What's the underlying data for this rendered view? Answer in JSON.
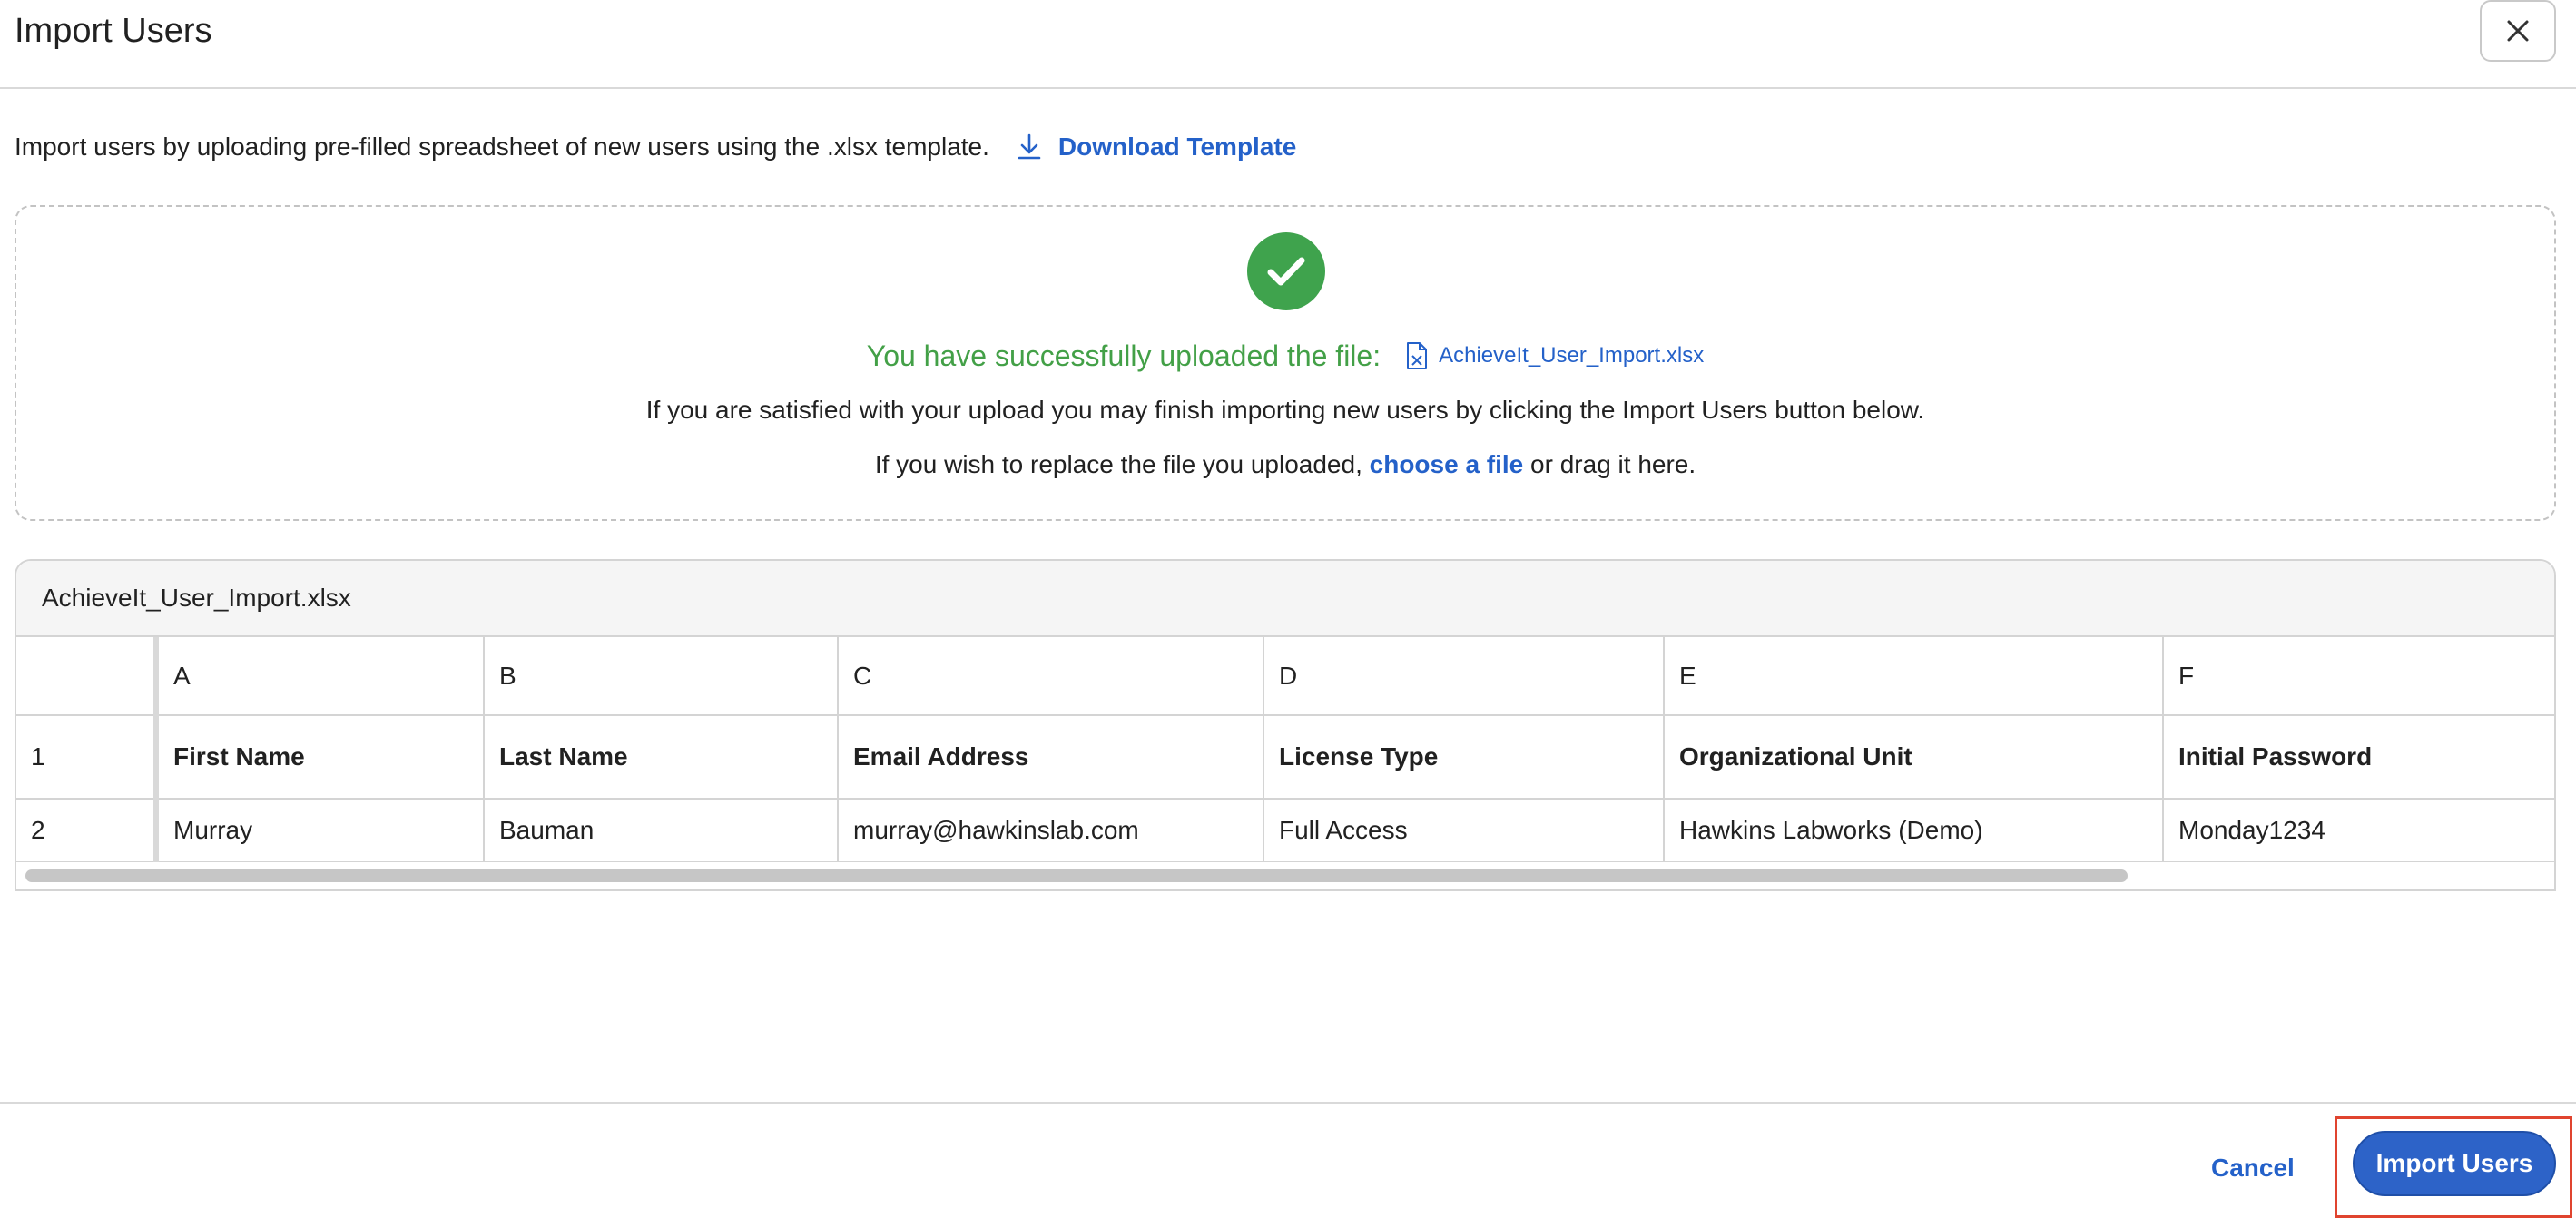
{
  "dialog": {
    "title": "Import Users"
  },
  "intro": {
    "text": "Import users by uploading pre-filled spreadsheet of new users using the .xlsx template.",
    "download_label": "Download Template"
  },
  "upload": {
    "success_text": "You have successfully uploaded the file:",
    "file_name": "AchieveIt_User_Import.xlsx",
    "info_line": "If you are satisfied with your upload you may finish importing new users by clicking the Import Users button below.",
    "replace_prefix": "If you wish to replace the file you uploaded,",
    "choose_link": "choose a file",
    "replace_suffix": "or drag it here."
  },
  "sheet": {
    "file_name": "AchieveIt_User_Import.xlsx",
    "column_letters": [
      "A",
      "B",
      "C",
      "D",
      "E",
      "F"
    ],
    "rows": [
      {
        "num": "1",
        "cells": [
          "First Name",
          "Last Name",
          "Email Address",
          "License Type",
          "Organizational Unit",
          "Initial Password"
        ]
      },
      {
        "num": "2",
        "cells": [
          "Murray",
          "Bauman",
          "murray@hawkinslab.com",
          "Full Access",
          "Hawkins Labworks (Demo)",
          "Monday1234"
        ]
      }
    ]
  },
  "footer": {
    "cancel_label": "Cancel",
    "import_label": "Import Users"
  },
  "colors": {
    "accent": "#2461c9",
    "success": "#43a047",
    "highlight": "#e0442f"
  }
}
